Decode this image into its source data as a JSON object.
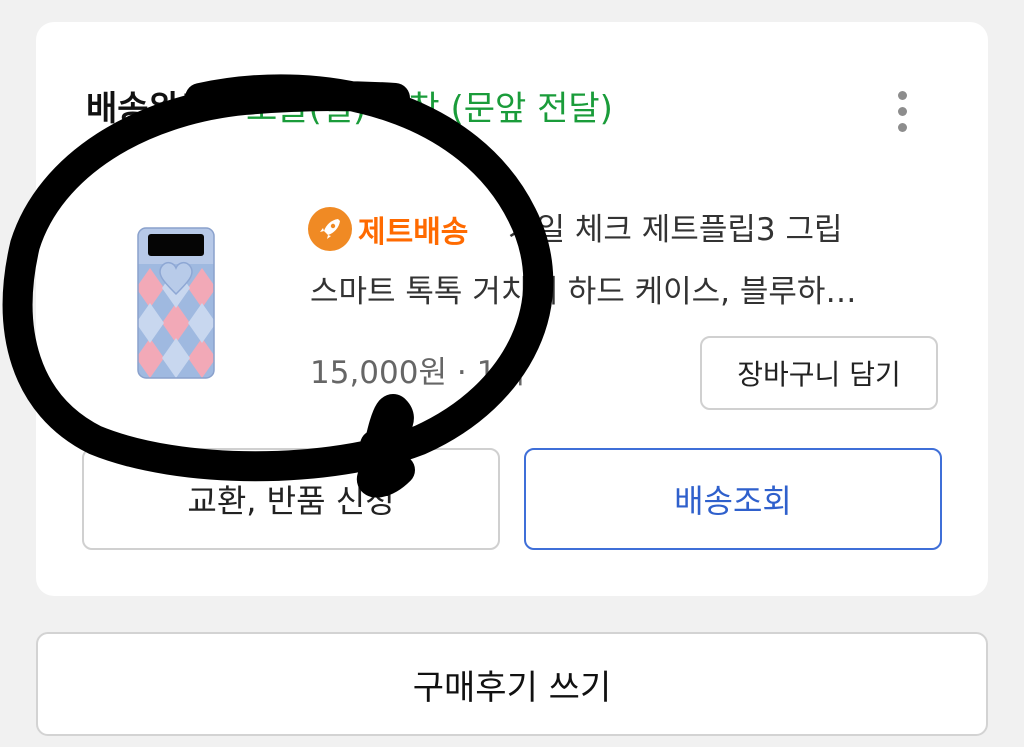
{
  "order": {
    "status_label": "배송완료",
    "status_detail": "오늘(일) 도착 (문앞 전달)"
  },
  "product": {
    "badge_label": "제트배송",
    "title_line1": "가일 체크 제트플립3 그립",
    "title_line2": "스마트 톡톡 거치대 하드 케이스, 블루하…",
    "price": "15,000원",
    "quantity": "1개"
  },
  "buttons": {
    "add_to_cart": "장바구니 담기",
    "exchange_return": "교환, 반품 신청",
    "track_delivery": "배송조회",
    "write_review": "구매후기 쓰기"
  },
  "colors": {
    "status_green": "#1a9c3a",
    "badge_orange": "#ff6a00",
    "track_blue": "#2f60cc"
  },
  "icons": {
    "more": "kebab-menu-icon",
    "badge": "rocket-icon"
  }
}
